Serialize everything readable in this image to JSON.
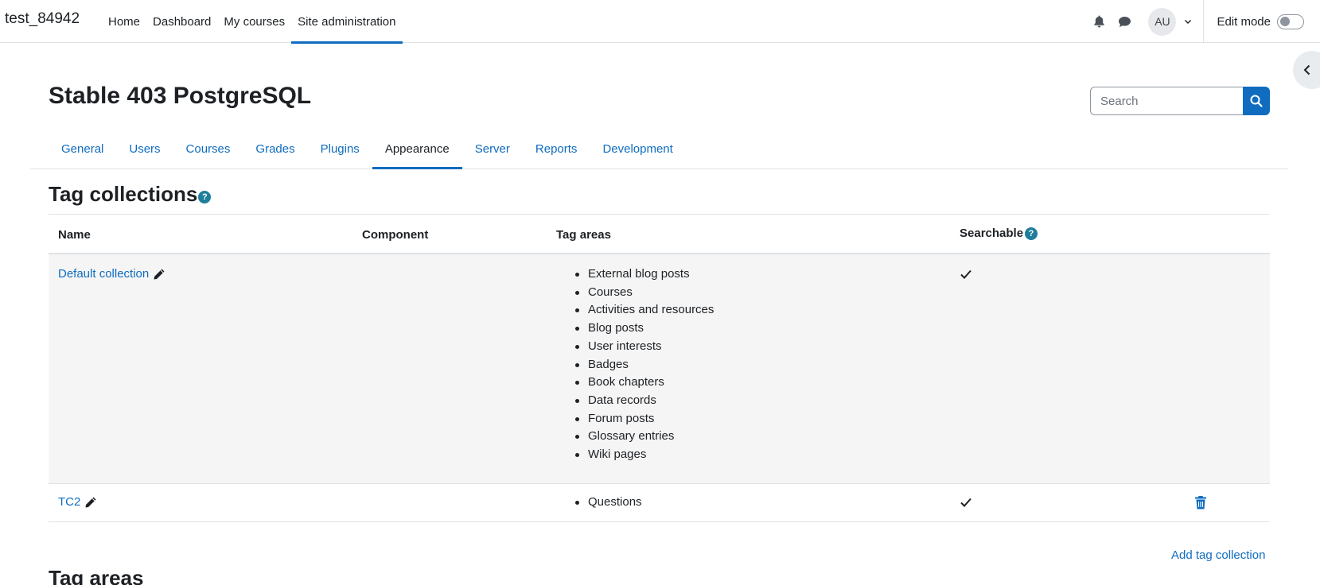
{
  "navbar": {
    "brand": "test_84942",
    "items": [
      {
        "label": "Home"
      },
      {
        "label": "Dashboard"
      },
      {
        "label": "My courses"
      },
      {
        "label": "Site administration",
        "active": true
      }
    ],
    "avatar_initials": "AU",
    "edit_mode_label": "Edit mode",
    "edit_mode_on": false
  },
  "header": {
    "title": "Stable 403 PostgreSQL",
    "search_placeholder": "Search"
  },
  "secondary_nav": {
    "items": [
      {
        "label": "General"
      },
      {
        "label": "Users"
      },
      {
        "label": "Courses"
      },
      {
        "label": "Grades"
      },
      {
        "label": "Plugins"
      },
      {
        "label": "Appearance",
        "active": true
      },
      {
        "label": "Server"
      },
      {
        "label": "Reports"
      },
      {
        "label": "Development"
      }
    ]
  },
  "tag_collections": {
    "title": "Tag collections",
    "columns": {
      "name": "Name",
      "component": "Component",
      "tag_areas": "Tag areas",
      "searchable": "Searchable"
    },
    "rows": [
      {
        "name": "Default collection",
        "component": "",
        "tag_areas": [
          "External blog posts",
          "Courses",
          "Activities and resources",
          "Blog posts",
          "User interests",
          "Badges",
          "Book chapters",
          "Data records",
          "Forum posts",
          "Glossary entries",
          "Wiki pages"
        ],
        "searchable": true,
        "deletable": false
      },
      {
        "name": "TC2",
        "component": "",
        "tag_areas": [
          "Questions"
        ],
        "searchable": true,
        "deletable": true
      }
    ],
    "add_link": "Add tag collection"
  },
  "tag_areas_section": {
    "title": "Tag areas"
  },
  "colors": {
    "primary": "#0f6cbf",
    "help_icon": "#1f7e9a",
    "stripe": "#f5f5f5",
    "border": "#dee2e6"
  }
}
